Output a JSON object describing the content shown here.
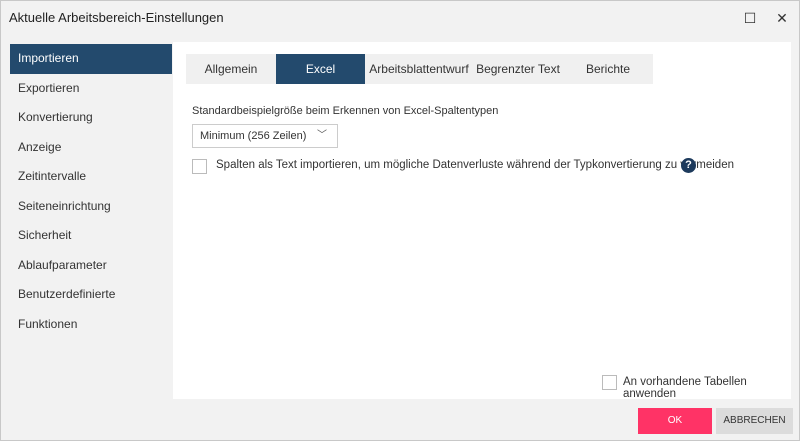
{
  "window": {
    "title": "Aktuelle Arbeitsbereich-Einstellungen"
  },
  "sidebar": {
    "items": [
      {
        "label": "Importieren"
      },
      {
        "label": "Exportieren"
      },
      {
        "label": "Konvertierung"
      },
      {
        "label": "Anzeige"
      },
      {
        "label": "Zeitintervalle"
      },
      {
        "label": "Seiteneinrichtung"
      },
      {
        "label": "Sicherheit"
      },
      {
        "label": "Ablaufparameter"
      },
      {
        "label": "Benutzerdefinierte Funktionen"
      }
    ]
  },
  "tabs": [
    {
      "label": "Allgemein"
    },
    {
      "label": "Excel"
    },
    {
      "label": "Arbeitsblattentwurf"
    },
    {
      "label": "Begrenzter Text"
    },
    {
      "label": "Berichte"
    }
  ],
  "excel": {
    "sample_label": "Standardbeispielgröße beim Erkennen von Excel-Spaltentypen",
    "sample_value": "Minimum (256 Zeilen)",
    "text_import_label": "Spalten als Text importieren, um mögliche Datenverluste während der Typkonvertierung zu vermeiden",
    "help": "?",
    "apply_existing_label": "An vorhandene Tabellen anwenden"
  },
  "buttons": {
    "ok": "OK",
    "cancel": "ABBRECHEN"
  },
  "colors": {
    "accent": "#234a6d",
    "ok": "#ff3366"
  }
}
